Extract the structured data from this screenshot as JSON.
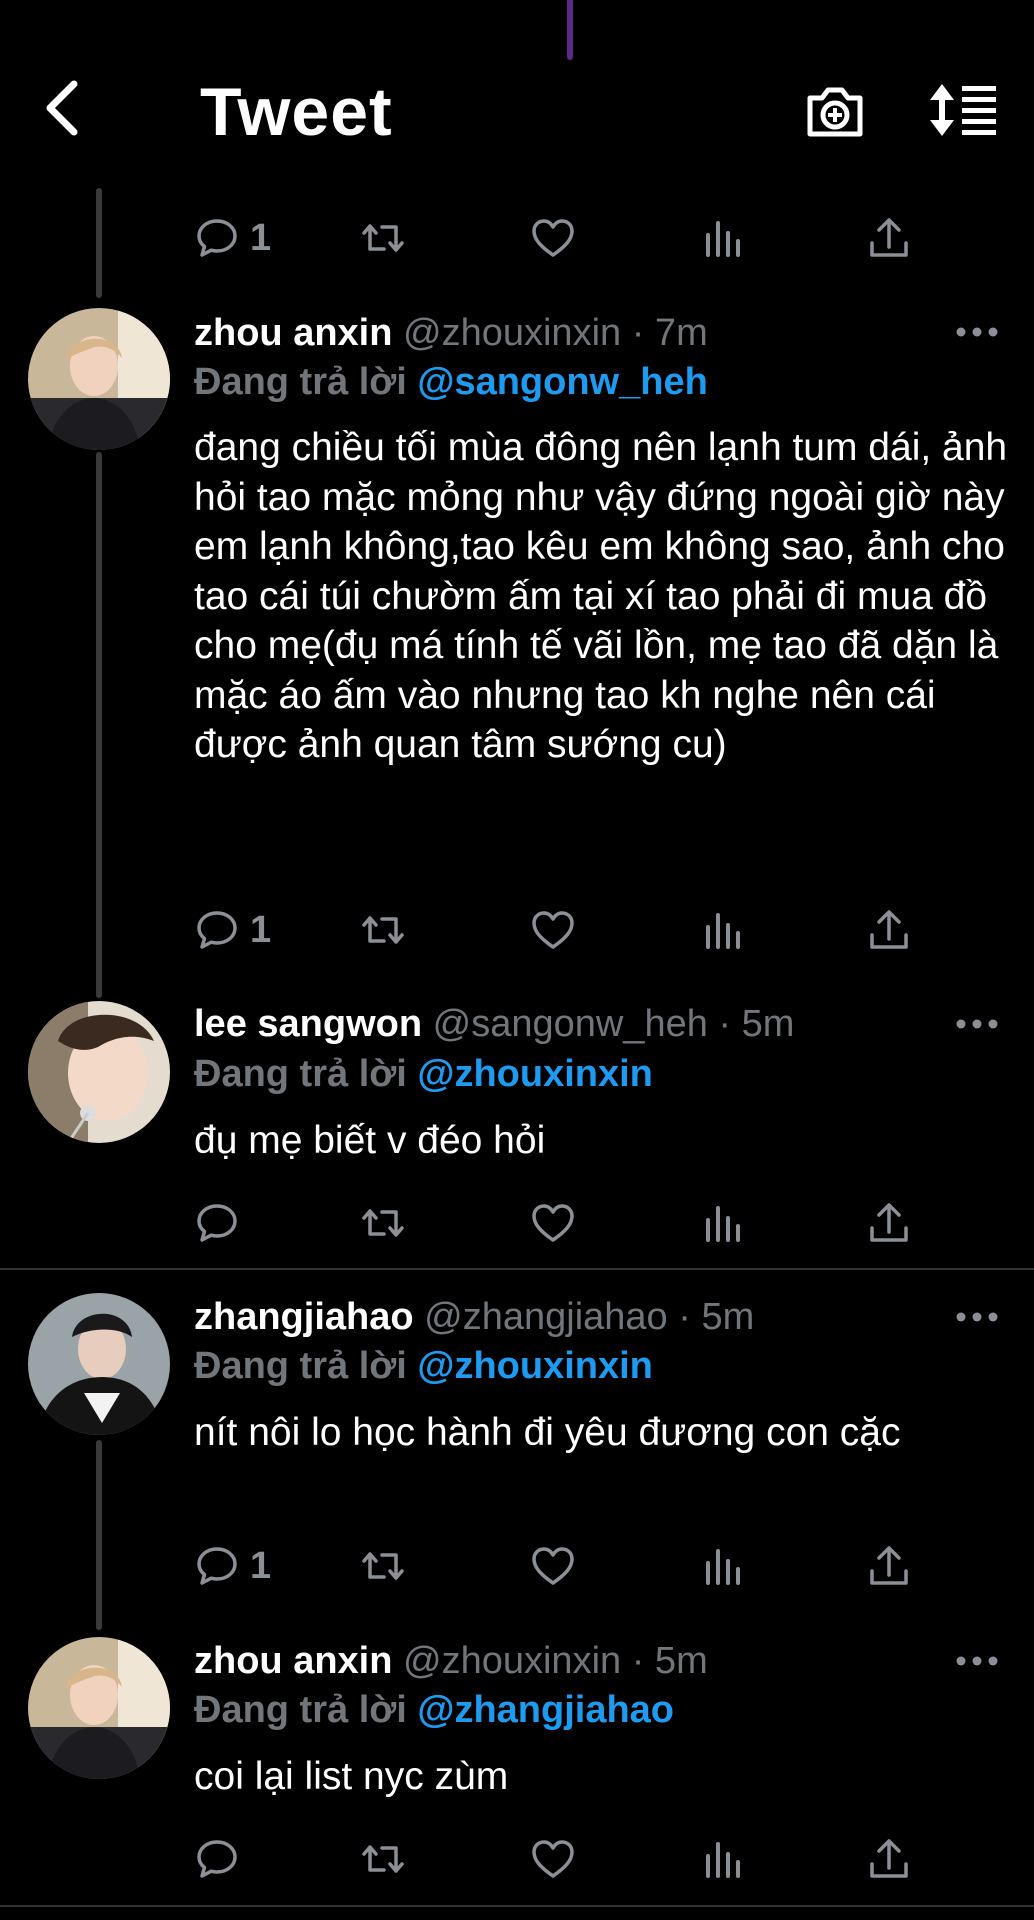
{
  "header": {
    "title": "Tweet",
    "back_icon": "chevron-left-icon",
    "camera_icon": "camera-plus-icon",
    "sort_icon": "sort-lines-icon"
  },
  "colors": {
    "background": "#000000",
    "mention": "#1d9bf0",
    "muted": "#71767b",
    "divider": "#2f3336"
  },
  "replying_prefix": "Đang trả lời",
  "top_actions": {
    "reply_count": "1"
  },
  "posts": [
    {
      "name": "zhou anxin",
      "handle": "@zhouxinxin",
      "time": "· 7m",
      "replying_to": "@sangonw_heh",
      "text": "đang chiều tối mùa đông nên lạnh tum dái, ảnh hỏi tao mặc mỏng như vậy đứng ngoài giờ này em lạnh không,tao kêu em không sao, ảnh cho tao cái túi chườm ấm tại xí tao phải đi mua đồ cho mẹ(đụ má tính tế vãi lồn, mẹ tao đã dặn là mặc áo ấm vào nhưng tao kh nghe nên cái được ảnh quan tâm sướng cu)",
      "reply_count": "1"
    },
    {
      "name": "lee sangwon",
      "handle": "@sangonw_heh",
      "time": "· 5m",
      "replying_to": "@zhouxinxin",
      "text": "đụ mẹ biết v đéo hỏi",
      "reply_count": ""
    },
    {
      "name": "zhangjiahao",
      "handle": "@zhangjiahao",
      "time": "· 5m",
      "replying_to": "@zhouxinxin",
      "text": "nít nôi lo học hành đi yêu đương con cặc",
      "reply_count": "1"
    },
    {
      "name": "zhou anxin",
      "handle": "@zhouxinxin",
      "time": "· 5m",
      "replying_to": "@zhangjiahao",
      "text": "coi lại list nyc zùm",
      "reply_count": ""
    }
  ]
}
